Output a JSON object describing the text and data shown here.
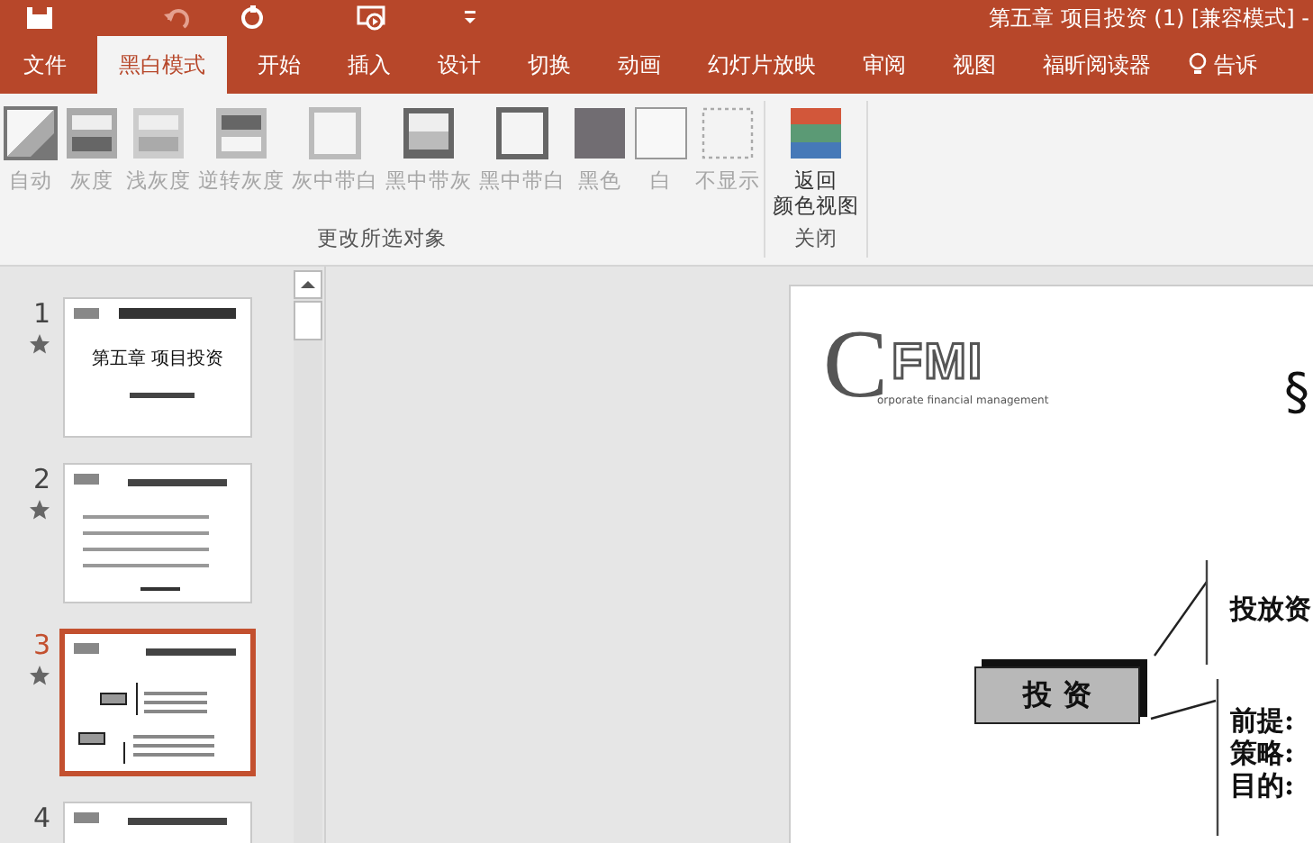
{
  "window": {
    "title": "第五章 项目投资 (1) [兼容模式] -"
  },
  "tabs": [
    {
      "label": "文件",
      "selected": false
    },
    {
      "label": "黑白模式",
      "selected": true
    },
    {
      "label": "开始",
      "selected": false
    },
    {
      "label": "插入",
      "selected": false
    },
    {
      "label": "设计",
      "selected": false
    },
    {
      "label": "切换",
      "selected": false
    },
    {
      "label": "动画",
      "selected": false
    },
    {
      "label": "幻灯片放映",
      "selected": false
    },
    {
      "label": "审阅",
      "selected": false
    },
    {
      "label": "视图",
      "selected": false
    },
    {
      "label": "福昕阅读器",
      "selected": false
    },
    {
      "label": "告诉",
      "selected": false,
      "kind": "tell"
    }
  ],
  "ribbon": {
    "groups": [
      {
        "label": "更改所选对象",
        "items": [
          {
            "label": "自动",
            "kind": "auto",
            "disabled": true
          },
          {
            "label": "灰度",
            "kind": "gray",
            "disabled": true
          },
          {
            "label": "浅灰度",
            "kind": "lightgray",
            "disabled": true
          },
          {
            "label": "逆转灰度",
            "kind": "inverse",
            "disabled": true
          },
          {
            "label": "灰中带白",
            "kind": "graywhite",
            "disabled": true
          },
          {
            "label": "黑中带灰",
            "kind": "blackgray",
            "disabled": true
          },
          {
            "label": "黑中带白",
            "kind": "blackwhite",
            "disabled": true
          },
          {
            "label": "黑色",
            "kind": "black",
            "disabled": true
          },
          {
            "label": "白",
            "kind": "white",
            "disabled": true
          },
          {
            "label": "不显示",
            "kind": "none",
            "disabled": true
          }
        ]
      },
      {
        "label": "关闭",
        "items": [
          {
            "label_lines": [
              "返回",
              "颜色视图"
            ],
            "kind": "color",
            "disabled": false
          }
        ]
      }
    ]
  },
  "slides": [
    {
      "number": "1",
      "selected": false,
      "animated": true,
      "title": "第五章 项目投资",
      "kind": "title"
    },
    {
      "number": "2",
      "selected": false,
      "animated": true,
      "kind": "list"
    },
    {
      "number": "3",
      "selected": true,
      "animated": true,
      "kind": "diagram"
    },
    {
      "number": "4",
      "selected": false,
      "animated": false,
      "kind": "header"
    }
  ],
  "slide": {
    "logo": {
      "letter": "C",
      "letters": "FMI",
      "tagline": "orporate financial management"
    },
    "heading": "§",
    "box": "投 资",
    "texts": [
      "投放资",
      "前提:",
      "策略:",
      "目的:"
    ]
  }
}
